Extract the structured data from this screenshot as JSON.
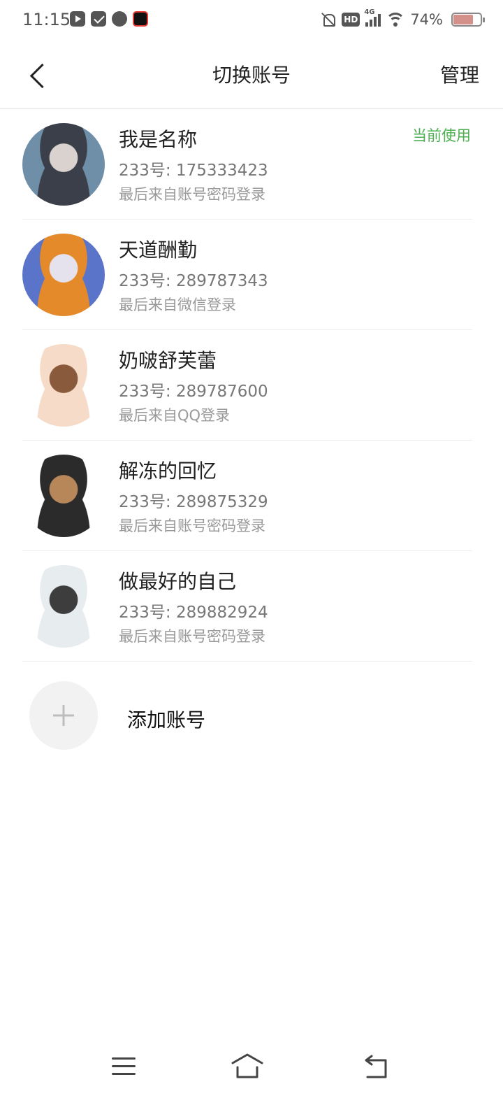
{
  "status_bar": {
    "time": "11:15",
    "notification_icons": [
      "video-app-icon",
      "mail-app-icon",
      "chat-app-icon",
      "media-app-icon"
    ],
    "hd_label": "HD",
    "network_label": "4G",
    "battery_percent_label": "74%",
    "battery_level": 0.74,
    "battery_color": "#d4918c"
  },
  "header": {
    "title": "切换账号",
    "manage_label": "管理"
  },
  "accounts": [
    {
      "name": "我是名称",
      "id_text": "233号: 175333423",
      "login_text": "最后来自账号密码登录",
      "status": "当前使用",
      "avatar_colors": [
        "#6f8fa8",
        "#d9d2cf",
        "#3a3f4a"
      ]
    },
    {
      "name": "天道酬勤",
      "id_text": "233号: 289787343",
      "login_text": "最后来自微信登录",
      "avatar_colors": [
        "#5a74c9",
        "#e5e2ee",
        "#e58a2a"
      ]
    },
    {
      "name": "奶啵舒芙蕾",
      "id_text": "233号: 289787600",
      "login_text": "最后来自QQ登录",
      "avatar_colors": [
        "#ffffff",
        "#8a5a3c",
        "#f6dcc8"
      ]
    },
    {
      "name": "解冻的回忆",
      "id_text": "233号: 289875329",
      "login_text": "最后来自账号密码登录",
      "avatar_colors": [
        "#ffffff",
        "#b7875a",
        "#2b2b2b"
      ]
    },
    {
      "name": "做最好的自己",
      "id_text": "233号: 289882924",
      "login_text": "最后来自账号密码登录",
      "avatar_colors": [
        "#ffffff",
        "#3d3d3d",
        "#e7ecef"
      ]
    }
  ],
  "add_account": {
    "label": "添加账号"
  },
  "colors": {
    "accent_green": "#4caf50",
    "divider": "#eeeeee"
  }
}
